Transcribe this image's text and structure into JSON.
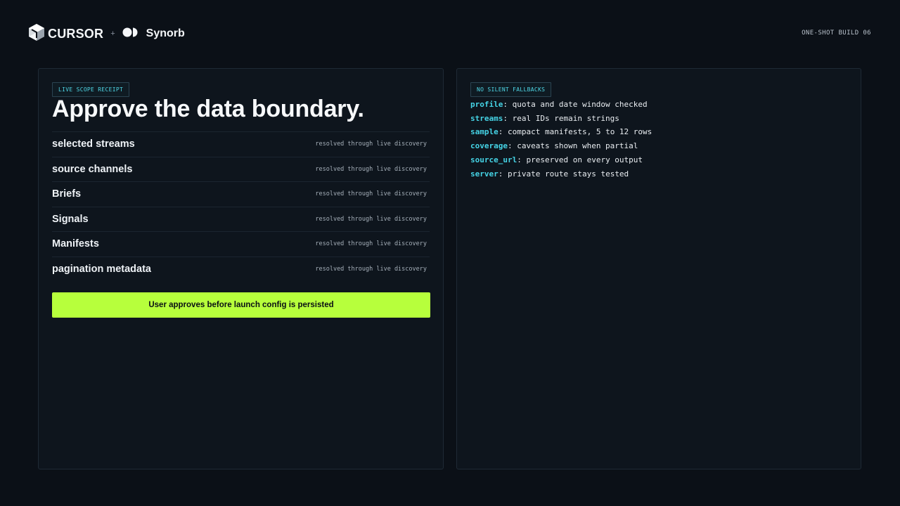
{
  "header": {
    "cursor_label": "CURSOR",
    "plus": "+",
    "synorb_label": "Synorb",
    "build_tag": "ONE-SHOT BUILD 06"
  },
  "icons": {
    "cursor": "cursor-cube-icon",
    "synorb": "synorb-orb-icon"
  },
  "colors": {
    "background": "#0b1017",
    "card": "#0e151d",
    "accent_cyan": "#45d3e5",
    "accent_lime": "#b7ff3c"
  },
  "scope_card": {
    "chip": "LIVE SCOPE RECEIPT",
    "title": "Approve the data boundary.",
    "rows": [
      {
        "label": "selected streams",
        "status": "resolved through live discovery"
      },
      {
        "label": "source channels",
        "status": "resolved through live discovery"
      },
      {
        "label": "Briefs",
        "status": "resolved through live discovery"
      },
      {
        "label": "Signals",
        "status": "resolved through live discovery"
      },
      {
        "label": "Manifests",
        "status": "resolved through live discovery"
      },
      {
        "label": "pagination metadata",
        "status": "resolved through live discovery"
      }
    ],
    "approve_label": "User approves before launch config is persisted"
  },
  "fallback_card": {
    "chip": "NO SILENT FALLBACKS",
    "lines": [
      {
        "key": "profile",
        "value": ": quota and date window checked"
      },
      {
        "key": "streams",
        "value": ": real IDs remain strings"
      },
      {
        "key": "sample",
        "value": ": compact manifests, 5 to 12 rows"
      },
      {
        "key": "coverage",
        "value": ": caveats shown when partial"
      },
      {
        "key": "source_url",
        "value": ": preserved on every output"
      },
      {
        "key": "server",
        "value": ": private route stays tested"
      }
    ]
  }
}
